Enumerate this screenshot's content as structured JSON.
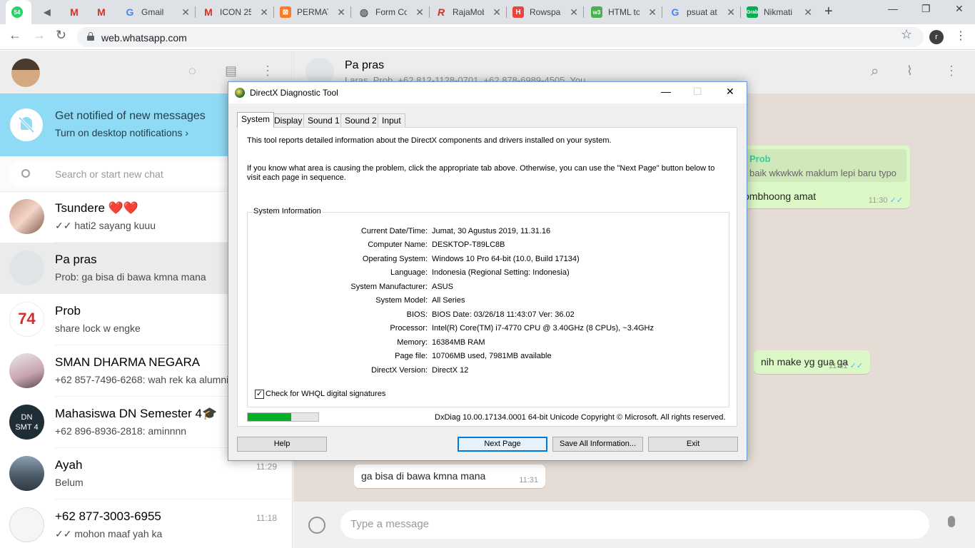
{
  "browser": {
    "tabs": [
      {
        "title": "",
        "icon": "whatsapp-icon",
        "color": "#25d366",
        "badge": "54"
      },
      {
        "title": "",
        "icon": "audio-icon",
        "color": "#5f6368"
      },
      {
        "title": "",
        "icon": "gmail-icon",
        "color": "#d93025"
      },
      {
        "title": "",
        "icon": "gmail-icon",
        "color": "#d93025"
      },
      {
        "title": "Gmail",
        "icon": "google-icon",
        "color": "#4285f4"
      },
      {
        "title": "ICON 25",
        "icon": "gmail-icon",
        "color": "#d93025"
      },
      {
        "title": "PERMAT",
        "icon": "xampp-icon",
        "color": "#fb7a24"
      },
      {
        "title": "Form Co",
        "icon": "globe-icon",
        "color": "#5f6368"
      },
      {
        "title": "RajaMob",
        "icon": "rajamobil-icon",
        "color": "#d93025"
      },
      {
        "title": "Rowspan",
        "icon": "h-icon",
        "color": "#e8453c"
      },
      {
        "title": "HTML to",
        "icon": "w3-icon",
        "color": "#4caf50"
      },
      {
        "title": "psuat at",
        "icon": "google-icon",
        "color": "#4285f4"
      },
      {
        "title": "Nikmati",
        "icon": "grab-icon",
        "color": "#00b14f"
      }
    ],
    "new_tab": "+",
    "url": "web.whatsapp.com",
    "profile_initial": "r"
  },
  "whatsapp": {
    "notification": {
      "title": "Get notified of new messages",
      "action": "Turn on desktop notifications ›"
    },
    "search_placeholder": "Search or start new chat",
    "chats": [
      {
        "name": "Tsundere ❤️❤️",
        "last": "✓✓ hati2 sayang kuuu",
        "time": "",
        "selected": false
      },
      {
        "name": "Pa pras",
        "last": "Prob: ga bisa di bawa kmna mana",
        "time": "",
        "selected": true
      },
      {
        "name": "Prob",
        "last": "share lock w engke",
        "time": "",
        "selected": false
      },
      {
        "name": "SMAN DHARMA NEGARA",
        "last": "+62 857-7496-6268: wah rek ka alumni",
        "time": "",
        "selected": false
      },
      {
        "name": "Mahasiswa DN Semester 4🎓",
        "last": "+62 896-8936-2818: aminnnn",
        "time": "",
        "selected": false
      },
      {
        "name": "Ayah",
        "last": "Belum",
        "time": "11:29",
        "selected": false
      },
      {
        "name": "+62 877-3003-6955",
        "last": "✓✓ mohon maaf yah ka",
        "time": "11:18",
        "selected": false
      }
    ],
    "conversation": {
      "name": "Pa pras",
      "members": "Laras, Prob, +62 812-1128-0701, +62 878-6989-4505, You",
      "quote_author": "Prob",
      "quote_text": "baik wkwkwk maklum lepi baru typo",
      "msg1_text": "ombhoong amat",
      "msg1_time": "11:30",
      "msg2_text": "nih make yg gua ga",
      "msg2_time": "11:31",
      "msg3_text": "ga bisa di bawa kmna mana",
      "msg3_time": "11:31",
      "input_placeholder": "Type a message"
    }
  },
  "dxdiag": {
    "title": "DirectX Diagnostic Tool",
    "tabs": [
      "System",
      "Display",
      "Sound 1",
      "Sound 2",
      "Input"
    ],
    "intro1": "This tool reports detailed information about the DirectX components and drivers installed on your system.",
    "intro2": "If you know what area is causing the problem, click the appropriate tab above.  Otherwise, you can use the \"Next Page\" button below to visit each page in sequence.",
    "group_label": "System Information",
    "rows": [
      {
        "label": "Current Date/Time:",
        "value": "Jumat, 30 Agustus 2019, 11.31.16"
      },
      {
        "label": "Computer Name:",
        "value": "DESKTOP-T89LC8B"
      },
      {
        "label": "Operating System:",
        "value": "Windows 10 Pro 64-bit (10.0, Build 17134)"
      },
      {
        "label": "Language:",
        "value": "Indonesia (Regional Setting: Indonesia)"
      },
      {
        "label": "System Manufacturer:",
        "value": "ASUS"
      },
      {
        "label": "System Model:",
        "value": "All Series"
      },
      {
        "label": "BIOS:",
        "value": "BIOS Date: 03/26/18 11:43:07 Ver: 36.02"
      },
      {
        "label": "Processor:",
        "value": "Intel(R) Core(TM) i7-4770 CPU @ 3.40GHz (8 CPUs), ~3.4GHz"
      },
      {
        "label": "Memory:",
        "value": "16384MB RAM"
      },
      {
        "label": "Page file:",
        "value": "10706MB used, 7981MB available"
      },
      {
        "label": "DirectX Version:",
        "value": "DirectX 12"
      }
    ],
    "whql_label": "Check for WHQL digital signatures",
    "whql_checked": true,
    "progress": 0.62,
    "copyright": "DxDiag 10.00.17134.0001 64-bit Unicode  Copyright © Microsoft. All rights reserved.",
    "buttons": {
      "help": "Help",
      "next": "Next Page",
      "save": "Save All Information...",
      "exit": "Exit"
    }
  }
}
